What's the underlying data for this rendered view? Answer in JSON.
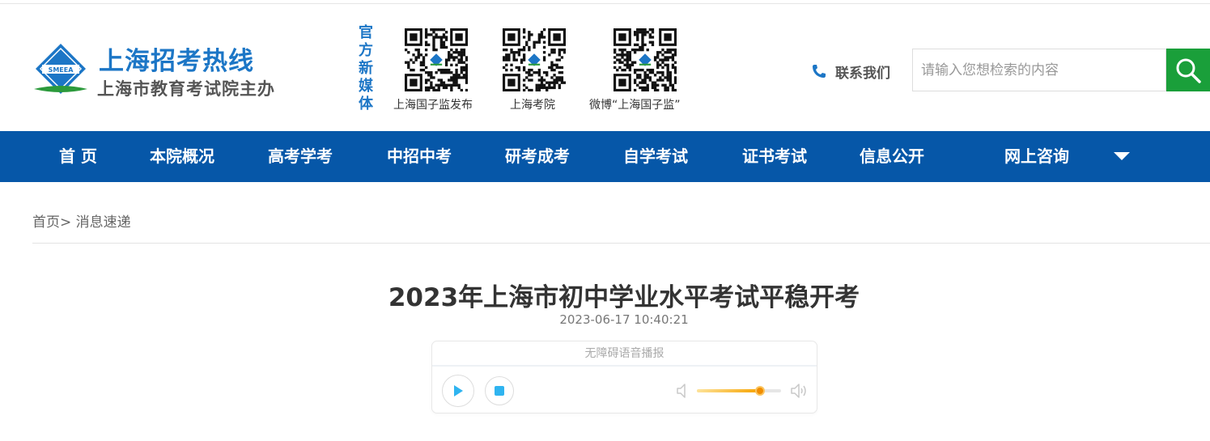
{
  "site": {
    "title": "上海招考热线",
    "subtitle": "上海市教育考试院主办",
    "emblem_text": "SMEEA"
  },
  "media": {
    "label": [
      "官",
      "方",
      "新",
      "媒",
      "体"
    ],
    "qrcodes": [
      {
        "caption": "上海国子监发布"
      },
      {
        "caption": "上海考院"
      },
      {
        "caption": "微博“上海国子监”"
      }
    ]
  },
  "contact": {
    "label": "联系我们"
  },
  "search": {
    "placeholder": "请输入您想检索的内容"
  },
  "nav": {
    "items": [
      "首 页",
      "本院概况",
      "高考学考",
      "中招中考",
      "研考成考",
      "自学考试",
      "证书考试",
      "信息公开",
      "网上咨询"
    ]
  },
  "breadcrumb": {
    "home": "首页",
    "separator": ">",
    "current": " 消息速递"
  },
  "article": {
    "title": "2023年上海市初中学业水平考试平稳开考",
    "date": "2023-06-17 10:40:21"
  },
  "player": {
    "header": "无障碍语音播报",
    "volume": 0.75
  },
  "colors": {
    "nav_bg": "#0657a8",
    "brand_blue": "#1c76c6",
    "search_green": "#1a9f3a",
    "player_accent": "#2fb4f0",
    "volume_orange": "#f18d00"
  }
}
